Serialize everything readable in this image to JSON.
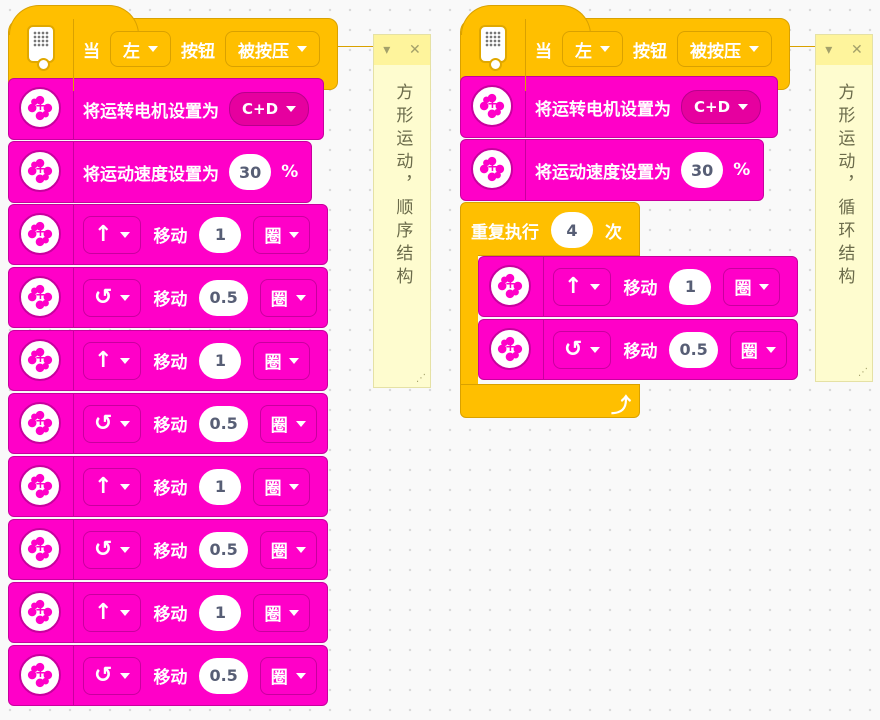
{
  "event": {
    "when_label": "当",
    "side_value": "左",
    "button_label": "按钮",
    "state_value": "被按压"
  },
  "motors": {
    "set_motor_label": "将运转电机设置为",
    "ports_value": "C+D",
    "set_speed_label": "将运动速度设置为",
    "speed_value": "30",
    "speed_unit": "%",
    "move_label": "移动",
    "unit_value": "圈"
  },
  "left_program": {
    "moves": [
      {
        "direction": "↑",
        "amount": "1"
      },
      {
        "direction": "↺",
        "amount": "0.5"
      },
      {
        "direction": "↑",
        "amount": "1"
      },
      {
        "direction": "↺",
        "amount": "0.5"
      },
      {
        "direction": "↑",
        "amount": "1"
      },
      {
        "direction": "↺",
        "amount": "0.5"
      },
      {
        "direction": "↑",
        "amount": "1"
      },
      {
        "direction": "↺",
        "amount": "0.5"
      }
    ],
    "comment": "方形运动，顺序结构"
  },
  "right_program": {
    "repeat_label": "重复执行",
    "repeat_count": "4",
    "repeat_suffix": "次",
    "moves": [
      {
        "direction": "↑",
        "amount": "1"
      },
      {
        "direction": "↺",
        "amount": "0.5"
      }
    ],
    "comment": "方形运动，循环结构"
  },
  "comment_controls": {
    "collapse": "▾",
    "close": "✕",
    "resize": "⋰"
  },
  "colors": {
    "event_yellow": "#ffbf00",
    "motor_pink": "#ff00c8",
    "note_bg": "#fefccf"
  }
}
